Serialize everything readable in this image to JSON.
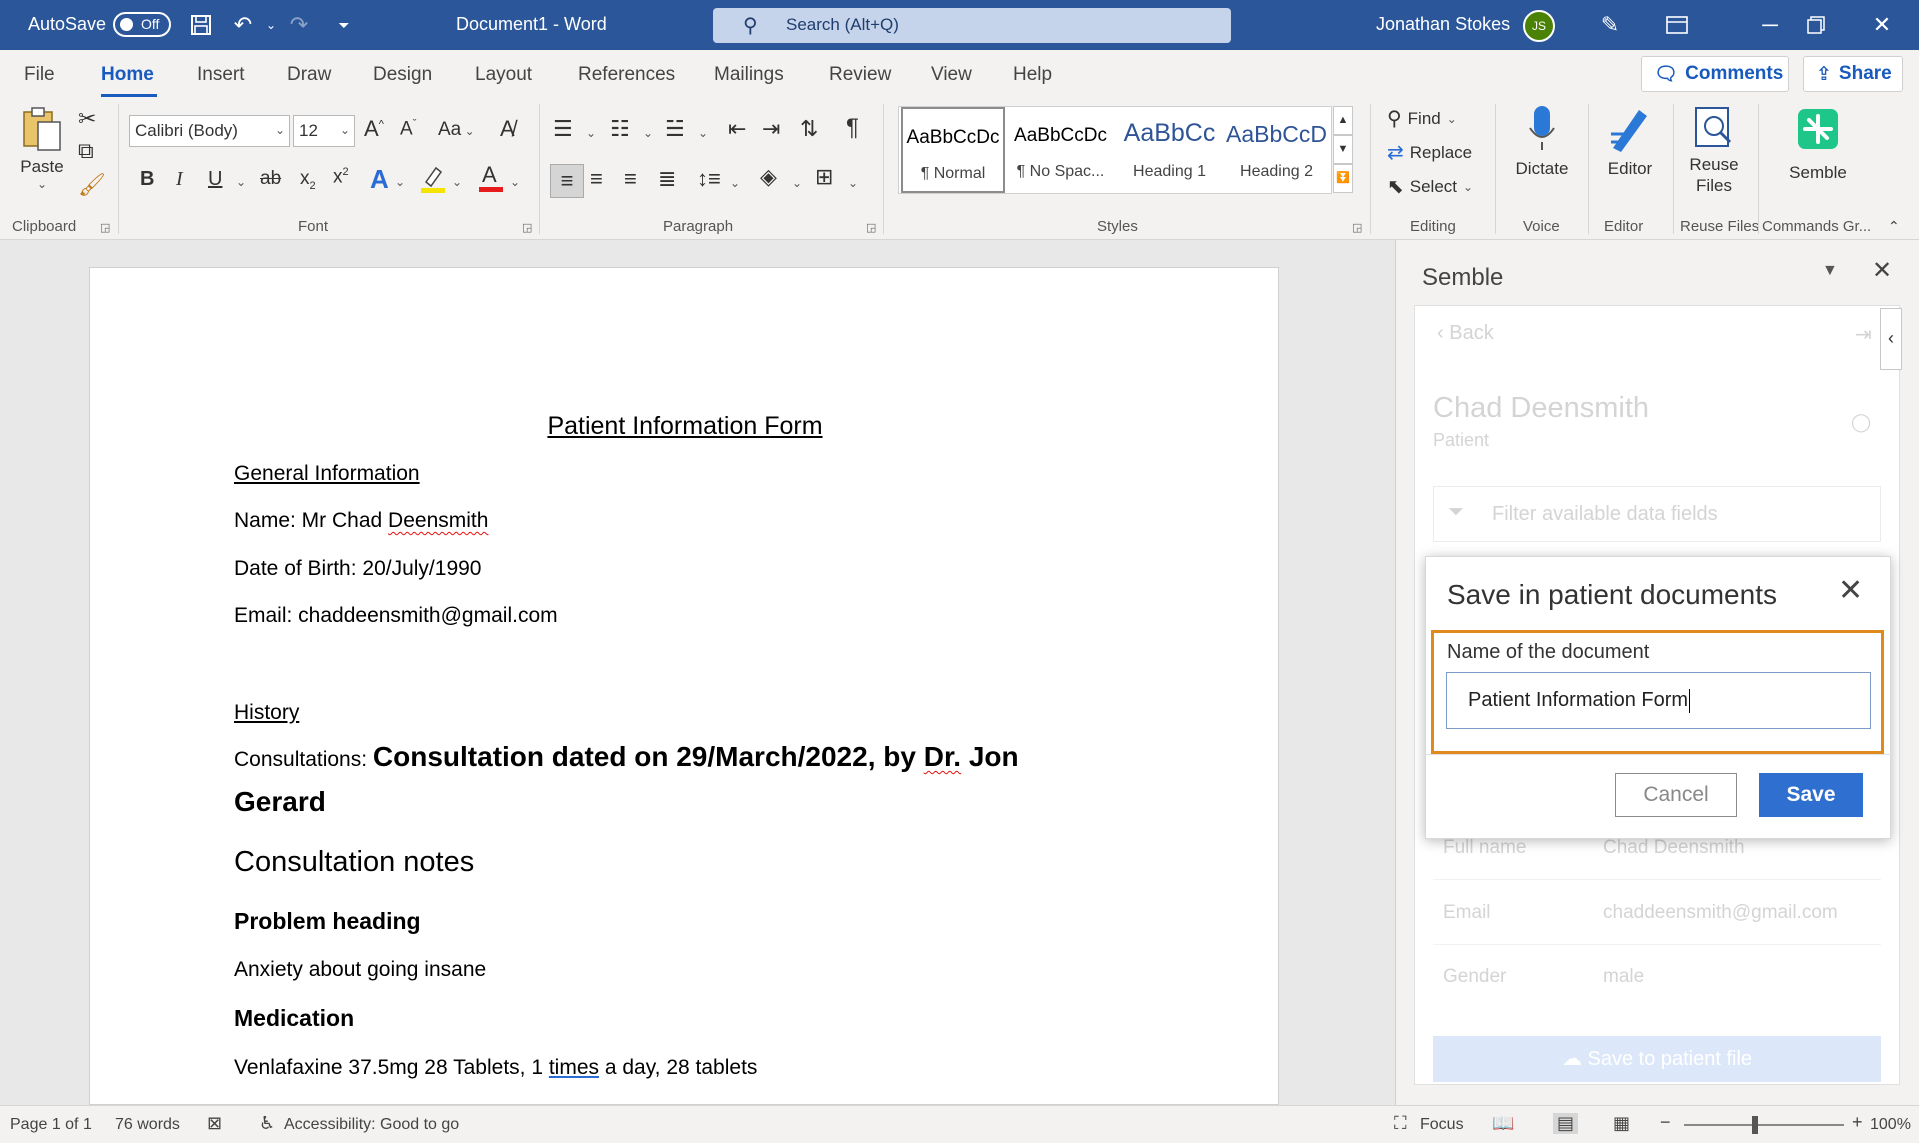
{
  "titlebar": {
    "autosave_label": "AutoSave",
    "autosave_state": "Off",
    "title": "Document1  -  Word",
    "search_placeholder": "Search (Alt+Q)",
    "user_name": "Jonathan Stokes",
    "user_initials": "JS",
    "accent_color": "#2b579a"
  },
  "tabs": {
    "items": [
      "File",
      "Home",
      "Insert",
      "Draw",
      "Design",
      "Layout",
      "References",
      "Mailings",
      "Review",
      "View",
      "Help"
    ],
    "active": "Home",
    "comments_label": "Comments",
    "share_label": "Share"
  },
  "ribbon": {
    "clipboard": {
      "paste_label": "Paste",
      "group_label": "Clipboard"
    },
    "font": {
      "font_name": "Calibri (Body)",
      "font_size": "12",
      "change_case": "Aa",
      "group_label": "Font"
    },
    "paragraph": {
      "group_label": "Paragraph"
    },
    "styles": {
      "group_label": "Styles",
      "items": [
        {
          "preview": "AaBbCcDc",
          "name": "¶ Normal"
        },
        {
          "preview": "AaBbCcDc",
          "name": "¶ No Spac..."
        },
        {
          "preview": "AaBbCc",
          "name": "Heading 1"
        },
        {
          "preview": "AaBbCcD",
          "name": "Heading 2"
        }
      ]
    },
    "editing": {
      "find_label": "Find",
      "replace_label": "Replace",
      "select_label": "Select",
      "group_label": "Editing"
    },
    "voice": {
      "dictate_label": "Dictate",
      "group_label": "Voice"
    },
    "editor": {
      "editor_label": "Editor",
      "group_label": "Editor"
    },
    "reuse": {
      "label_line1": "Reuse",
      "label_line2": "Files",
      "group_label": "Reuse Files"
    },
    "semble": {
      "label": "Semble",
      "group_label": "Commands Gr..."
    }
  },
  "document": {
    "title": "Patient Information Form",
    "general_heading": "General Information",
    "name_prefix": "Name: Mr Chad ",
    "name_surname": "Deensmith",
    "dob": "Date of Birth: 20/July/1990",
    "email": "Email: chaddeensmith@gmail.com",
    "history_heading": "History",
    "consult_prefix": "Consultations: ",
    "consult_line1a": "Consultation dated on 29/March/2022, by ",
    "consult_dr": "Dr.",
    "consult_line1b": " Jon",
    "consult_line2": "Gerard",
    "consult_notes": "Consultation notes",
    "problem_heading": "Problem heading",
    "problem_text": "Anxiety about going insane",
    "medication_heading": "Medication",
    "med_prefix": "Venlafaxine 37.5mg 28 Tablets, 1 ",
    "med_times": "times",
    "med_suffix": " a day, 28 tablets"
  },
  "pane": {
    "title": "Semble",
    "back_label": "Back",
    "patient_name": "Chad Deensmith",
    "patient_role": "Patient",
    "filter_placeholder": "Filter available data fields",
    "fields": [
      {
        "label": "Full name",
        "value": "Chad Deensmith"
      },
      {
        "label": "Email",
        "value": "chaddeensmith@gmail.com"
      },
      {
        "label": "Gender",
        "value": "male"
      }
    ],
    "save_file_label": "Save to patient file"
  },
  "dialog": {
    "title": "Save in patient documents",
    "field_label": "Name of the document",
    "field_value": "Patient Information Form",
    "cancel_label": "Cancel",
    "save_label": "Save",
    "highlight_color": "#e08a1e",
    "save_color": "#2f6fcf"
  },
  "status": {
    "page": "Page 1 of 1",
    "words": "76 words",
    "accessibility": "Accessibility: Good to go",
    "focus_label": "Focus",
    "zoom": "100%"
  }
}
